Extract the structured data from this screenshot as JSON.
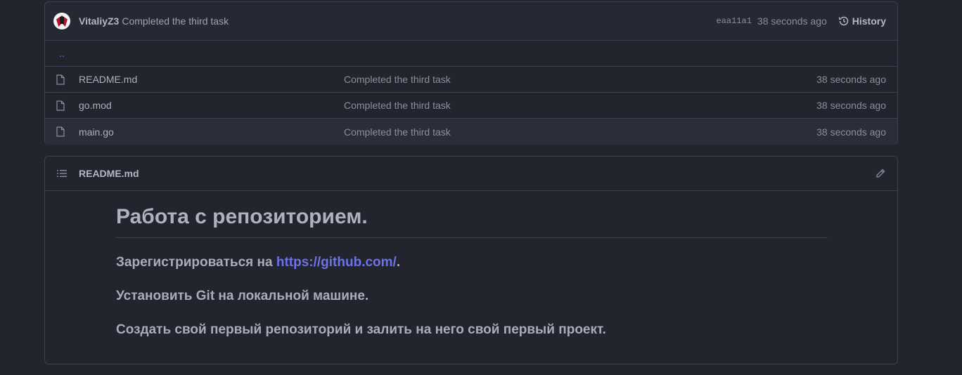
{
  "commit": {
    "author": "VitaliyZ3",
    "message": "Completed the third task",
    "sha": "eaa11a1",
    "time_ago": "38 seconds ago",
    "history_label": "History"
  },
  "parent_link": "..",
  "files": [
    {
      "name": "README.md",
      "message": "Completed the third task",
      "time_ago": "38 seconds ago"
    },
    {
      "name": "go.mod",
      "message": "Completed the third task",
      "time_ago": "38 seconds ago"
    },
    {
      "name": "main.go",
      "message": "Completed the third task",
      "time_ago": "38 seconds ago"
    }
  ],
  "readme": {
    "title": "README.md",
    "heading": "Работа с репозиторием.",
    "p1_text": "Зарегистрироваться на ",
    "p1_link": "https://github.com/",
    "p1_tail": ".",
    "p2": "Установить Git на локальной машине.",
    "p3": "Создать свой первый репозиторий и залить на него свой первый проект."
  },
  "icons": [
    "history-icon",
    "file-icon",
    "list-icon",
    "pencil-icon"
  ],
  "colors": {
    "background": "#22242e",
    "border": "#3d404d",
    "link": "#6c72e8"
  }
}
